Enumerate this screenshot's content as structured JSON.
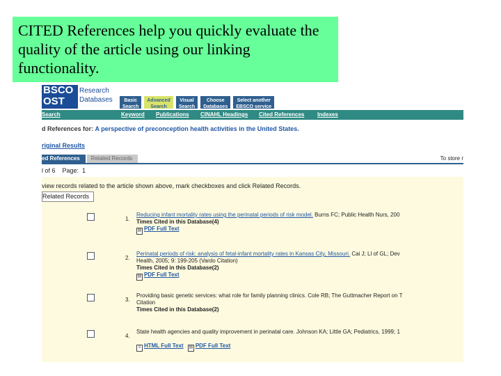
{
  "callout": {
    "text": "CITED References help you quickly evaluate the quality of the article using our linking functionality."
  },
  "header": {
    "logo_mark": "BSCO\nOST",
    "logo_text": "Research\nDatabases",
    "tabs": [
      {
        "label": "Basic\nSearch"
      },
      {
        "label": "Advanced\nSearch"
      },
      {
        "label": "Visual\nSearch"
      },
      {
        "label": "Choose\nDatabases"
      },
      {
        "label": "Select another\nEBSCO service"
      }
    ]
  },
  "navbar": {
    "left": "Search",
    "items": [
      "Keyword",
      "Publications",
      "CINAHL Headings",
      "Cited References",
      "Indexes"
    ]
  },
  "results": {
    "title_prefix": "d References for:",
    "article_title": "A perspective of preconception health activities in the United States.",
    "original_results": "riginal Results",
    "tab_cited": "ed References",
    "tab_related": "Related Records",
    "store_text": "To store r",
    "paging": "l of 6    Page:  1",
    "instruction": "view records related to the article shown above, mark checkboxes and click Related Records.",
    "related_button": "Related Records"
  },
  "records": [
    {
      "num": "1.",
      "link": "Reducing infant mortality rates using the perinatal periods of risk model.",
      "rest": " Burns FC; Public Health Nurs, 200",
      "line2": "",
      "times": "Times Cited in this Database(4)",
      "fulltext": [
        "PDF Full Text"
      ]
    },
    {
      "num": "2.",
      "link": "Perinatal periods of risk: analysis of fetal-infant mortality rates in Kansas City, Missouri.",
      "rest": " Cai J; Ll of GL; Dev",
      "line2": "Health, 2005; 9: 199-205 (Vardo Citation)",
      "times": "Times Cited in this Database(2)",
      "fulltext": [
        "PDF Full Text"
      ]
    },
    {
      "num": "3.",
      "link": "",
      "rest": "Providing basic genetic services: what role for family planning clinics. Cole RB; The Guttmacher Report on T",
      "line2": "Citation",
      "times": "Times Cited in this Database(2)",
      "fulltext": []
    },
    {
      "num": "4.",
      "link": "",
      "rest": "State health agencies and quality improvement in perinatal care. Johnson KA; Little GA; Pediatrics, 1999; 1",
      "line2": "",
      "times": "",
      "fulltext": [
        "HTML Full Text",
        "PDF Full Text"
      ]
    }
  ]
}
